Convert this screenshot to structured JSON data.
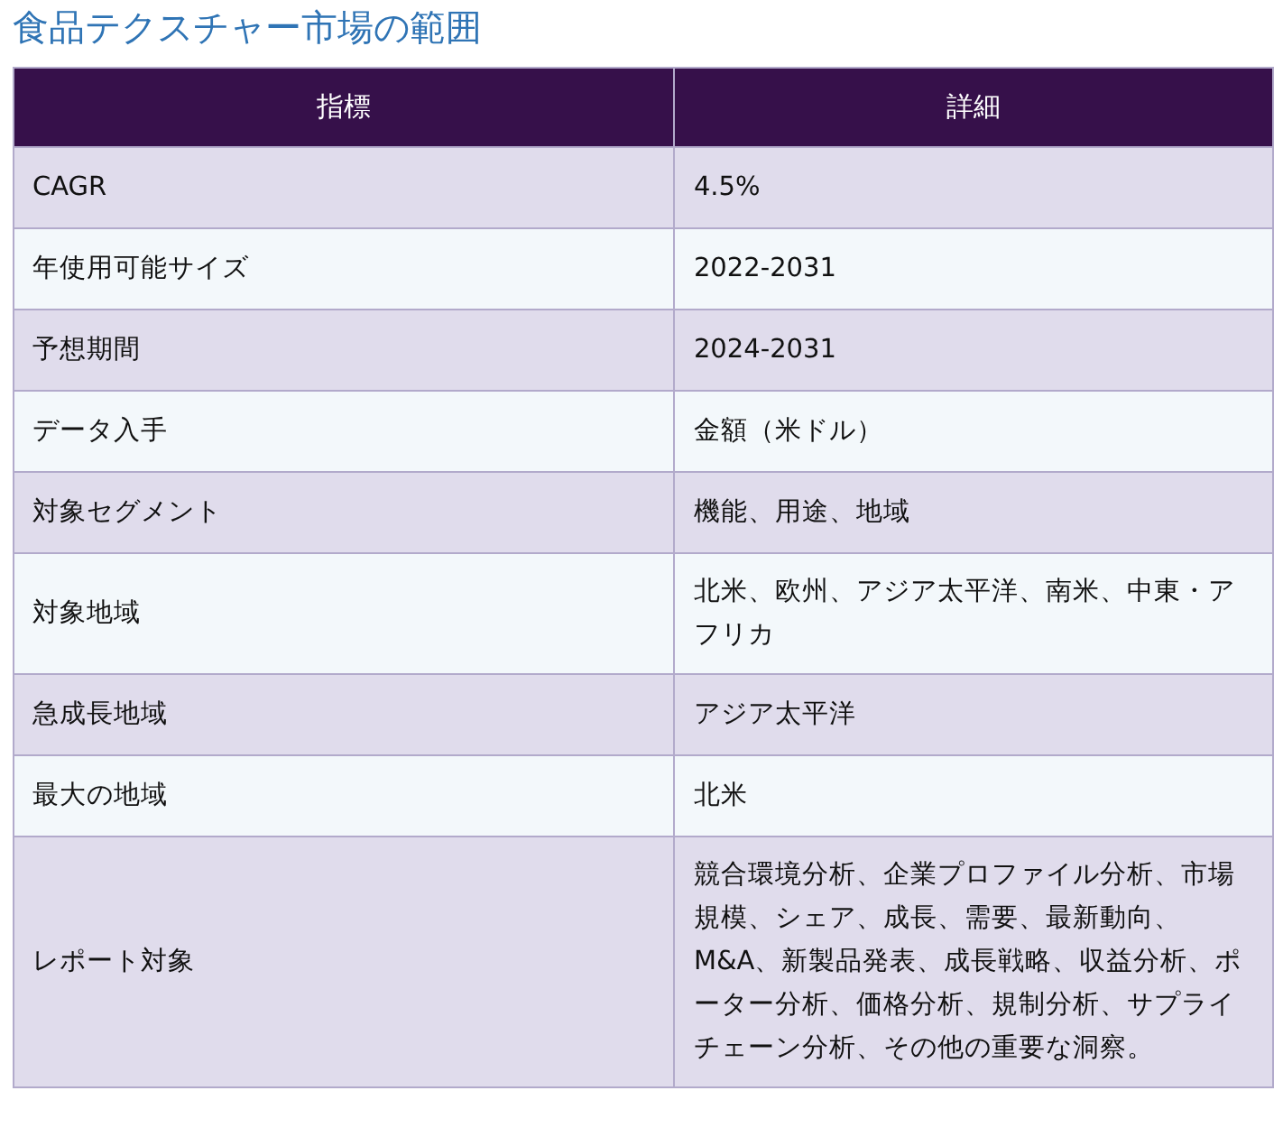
{
  "title": "食品テクスチャー市場の範囲",
  "table": {
    "columns": [
      "指標",
      "詳細"
    ],
    "rows": [
      {
        "metric": "CAGR",
        "detail": "4.5%"
      },
      {
        "metric": "年使用可能サイズ",
        "detail": "2022-2031"
      },
      {
        "metric": "予想期間",
        "detail": "2024-2031"
      },
      {
        "metric": "データ入手",
        "detail": "金額（米ドル）"
      },
      {
        "metric": "対象セグメント",
        "detail": "機能、用途、地域"
      },
      {
        "metric": "対象地域",
        "detail": "北米、欧州、アジア太平洋、南米、中東・アフリカ"
      },
      {
        "metric": "急成長地域",
        "detail": "アジア太平洋"
      },
      {
        "metric": "最大の地域",
        "detail": "北米"
      },
      {
        "metric": "レポート対象",
        "detail": "競合環境分析、企業プロファイル分析、市場規模、シェア、成長、需要、最新動向、M&A、新製品発表、成長戦略、収益分析、ポーター分析、価格分析、規制分析、サプライチェーン分析、その他の重要な洞察。"
      }
    ]
  }
}
